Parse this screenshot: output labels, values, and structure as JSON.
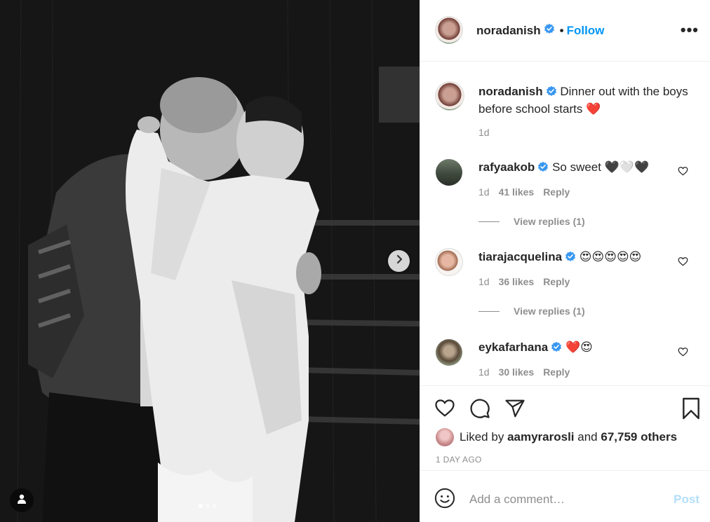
{
  "post": {
    "image": {
      "carousel_dots": 3,
      "active_dot": 1,
      "next_icon": "chevron-right-icon",
      "tag_icon": "user-tag-icon"
    },
    "header": {
      "username": "noradanish",
      "verified": true,
      "separator": "•",
      "follow_label": "Follow",
      "more_icon": "more-options-icon",
      "more_label": "•••"
    },
    "caption": {
      "username": "noradanish",
      "text": "Dinner out with the boys before school starts",
      "emoji": "❤️",
      "time": "1d"
    },
    "comments": [
      {
        "username": "rafyaakob",
        "text": "So sweet",
        "emoji": "🖤🤍🖤",
        "time": "1d",
        "likes": "41 likes",
        "reply": "Reply",
        "view_replies": "View replies (1)"
      },
      {
        "username": "tiarajacquelina",
        "text": "",
        "emoji": "😍😍😍😍😍",
        "time": "1d",
        "likes": "36 likes",
        "reply": "Reply",
        "view_replies": "View replies (1)"
      },
      {
        "username": "eykafarhana",
        "text": "",
        "emoji": "❤️😍",
        "time": "1d",
        "likes": "30 likes",
        "reply": "Reply"
      }
    ],
    "actions": {
      "like_icon": "heart-icon",
      "comment_icon": "comment-icon",
      "share_icon": "share-icon",
      "save_icon": "bookmark-icon"
    },
    "likes": {
      "prefix": "Liked by",
      "user": "aamyrarosli",
      "middle": "and",
      "others": "67,759 others"
    },
    "timestamp": "1 DAY AGO",
    "add_comment": {
      "emoji_icon": "smiley-icon",
      "placeholder": "Add a comment…",
      "post_label": "Post"
    },
    "colors": {
      "accent": "#0095f6",
      "verified": "#3897f0",
      "muted": "#8e8e8e",
      "post_disabled": "#b2dffc"
    }
  }
}
